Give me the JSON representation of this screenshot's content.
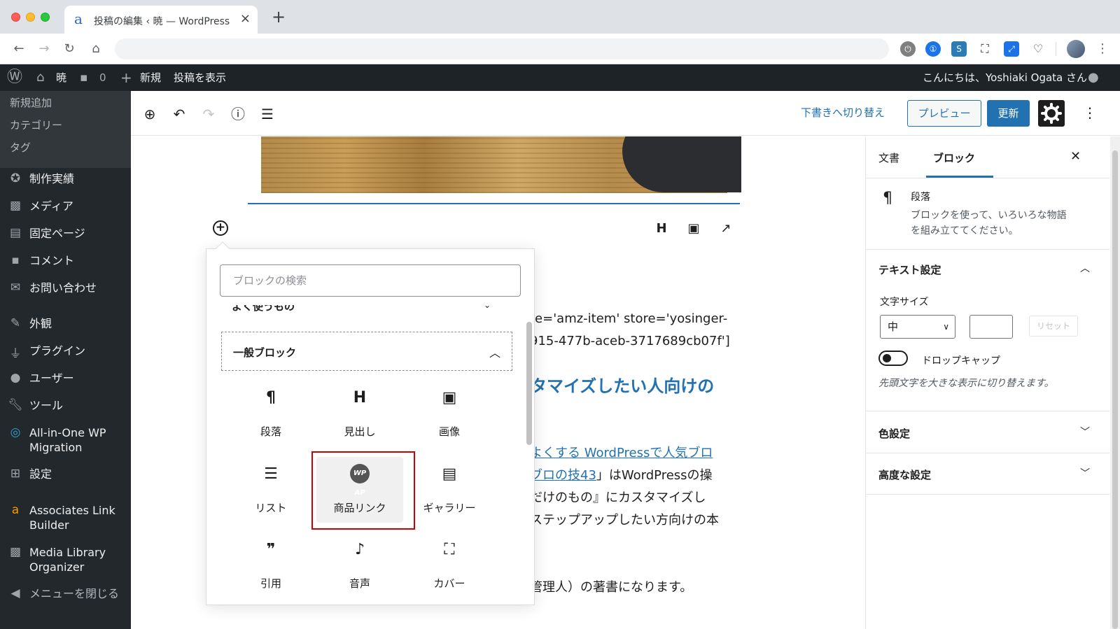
{
  "browser": {
    "tab_title": "投稿の編集 ‹ 暁 — WordPress",
    "tab_close": "×",
    "new_tab": "+"
  },
  "adminbar": {
    "site_name": "暁",
    "comments_count": "0",
    "new_label": "新規",
    "view_post": "投稿を表示",
    "greeting": "こんにちは、Yoshiaki Ogata さん"
  },
  "sidebar_menu": {
    "submenu": [
      "新規追加",
      "カテゴリー",
      "タグ"
    ],
    "items": [
      {
        "icon": "award-icon",
        "label": "制作実績"
      },
      {
        "icon": "media-icon",
        "label": "メディア"
      },
      {
        "icon": "page-icon",
        "label": "固定ページ"
      },
      {
        "icon": "comment-icon",
        "label": "コメント"
      },
      {
        "icon": "mail-icon",
        "label": "お問い合わせ"
      },
      {
        "icon": "brush-icon",
        "label": "外観"
      },
      {
        "icon": "plugin-icon",
        "label": "プラグイン"
      },
      {
        "icon": "user-icon",
        "label": "ユーザー"
      },
      {
        "icon": "wrench-icon",
        "label": "ツール"
      },
      {
        "icon": "migration-icon",
        "label": "All-in-One WP\nMigration"
      },
      {
        "icon": "settings-icon",
        "label": "設定"
      },
      {
        "icon": "amazon-icon",
        "label": "Associates Link\nBuilder"
      },
      {
        "icon": "media-icon",
        "label": "Media Library\nOrganizer"
      },
      {
        "icon": "collapse-icon",
        "label": "メニューを閉じる"
      }
    ]
  },
  "editor_header": {
    "switch_to_draft": "下書きへ切り替え",
    "preview": "プレビュー",
    "update": "更新"
  },
  "content": {
    "line1": "te='amz-item' store='yosinger-",
    "line2": "915-477b-aceb-3717689cb07f']",
    "heading": "タマイズしたい人向けの",
    "link1": "よくする WordPressで人気ブロ",
    "link2": "ブロの技43",
    "line3_rest": "」はWordPressの操",
    "line4": "だけのもの』にカスタマイズし",
    "line5": "ステップアップしたい方向けの本",
    "line6": "管理人）の著書になります。"
  },
  "inserter": {
    "search_placeholder": "ブロックの検索",
    "frequent_title": "よく使うもの",
    "category_title": "一般ブロック",
    "blocks": [
      {
        "icon": "paragraph-icon",
        "glyph": "¶",
        "label": "段落"
      },
      {
        "icon": "heading-icon",
        "glyph": "H",
        "label": "見出し"
      },
      {
        "icon": "image-icon",
        "glyph": "▣",
        "label": "画像"
      },
      {
        "icon": "list-icon",
        "glyph": "☰",
        "label": "リスト"
      },
      {
        "icon": "wpap-icon",
        "glyph": "WP AP",
        "label": "商品リンク"
      },
      {
        "icon": "gallery-icon",
        "glyph": "▤",
        "label": "ギャラリー"
      },
      {
        "icon": "quote-icon",
        "glyph": "❞",
        "label": "引用"
      },
      {
        "icon": "audio-icon",
        "glyph": "♪",
        "label": "音声"
      },
      {
        "icon": "cover-icon",
        "glyph": "⛶",
        "label": "カバー"
      }
    ]
  },
  "settings_sidebar": {
    "tab_document": "文書",
    "tab_block": "ブロック",
    "block_name": "段落",
    "block_desc_1": "ブロックを使って、いろいろな物語",
    "block_desc_2": "を組み立ててください。",
    "text_settings": "テキスト設定",
    "font_size_label": "文字サイズ",
    "font_size_value": "中",
    "reset": "リセット",
    "drop_cap": "ドロップキャップ",
    "drop_cap_help": "先頭文字を大きな表示に切り替えます。",
    "color_settings": "色設定",
    "advanced": "高度な設定"
  }
}
